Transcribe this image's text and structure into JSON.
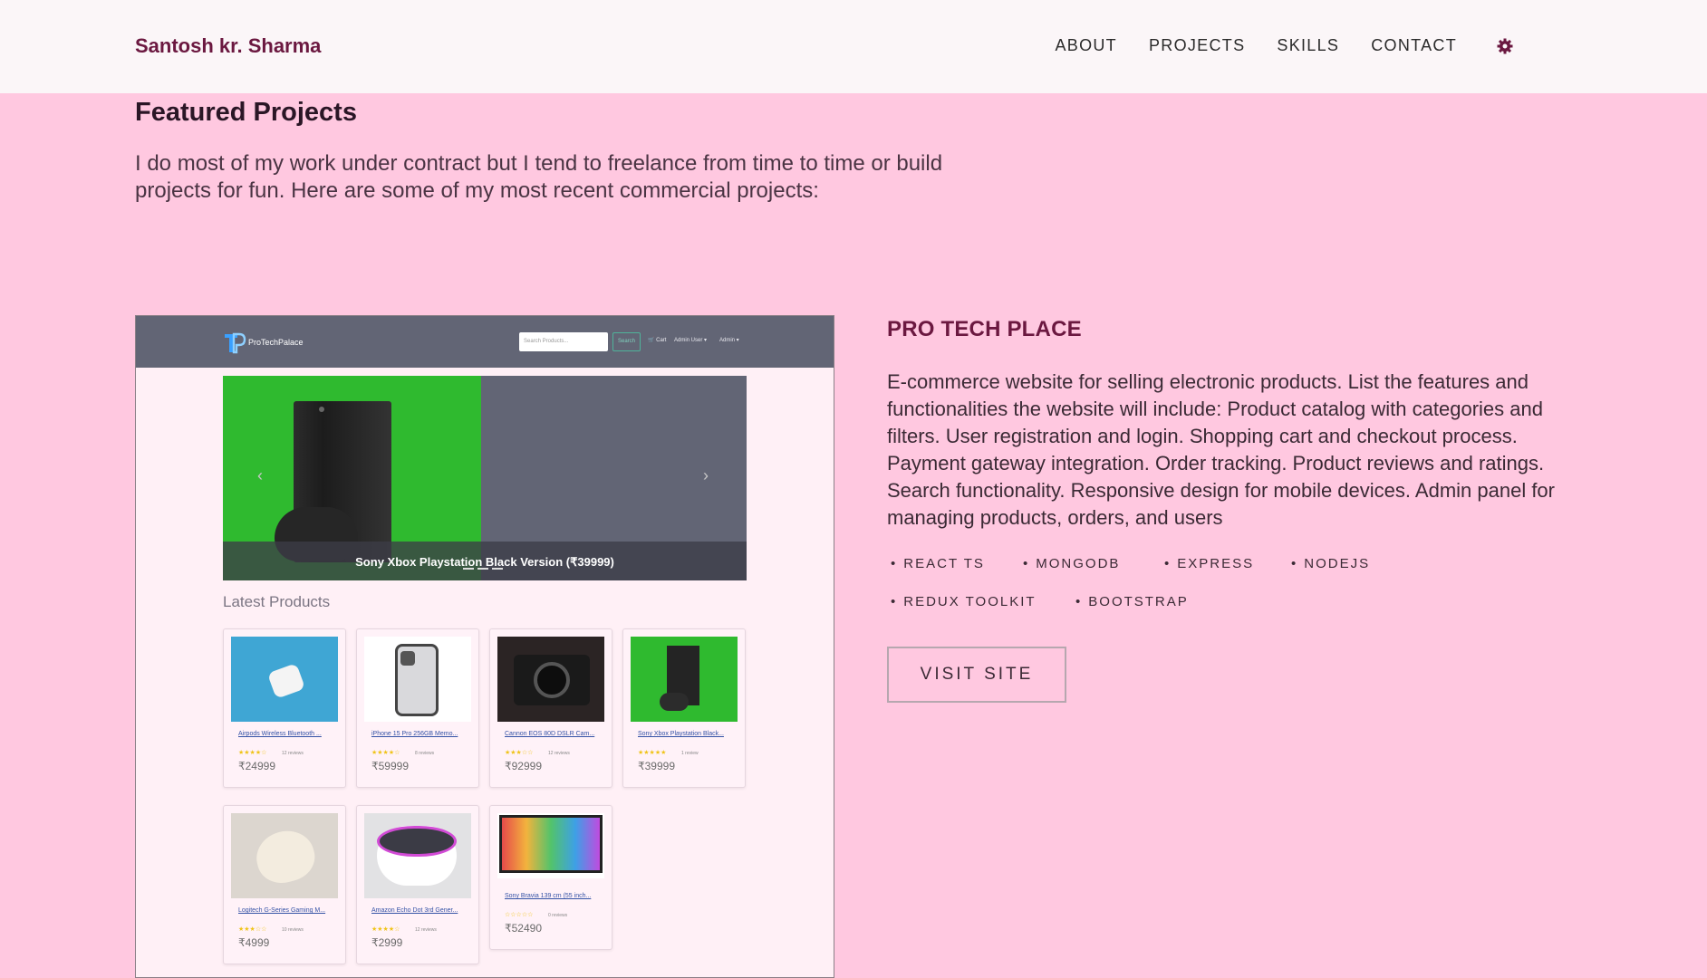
{
  "brand": {
    "name": "Santosh kr. Sharma"
  },
  "nav": {
    "items": [
      "ABOUT",
      "PROJECTS",
      "SKILLS",
      "CONTACT"
    ],
    "settings_icon": "gear-icon"
  },
  "section": {
    "title": "Featured Projects",
    "intro": "I do most of my work under contract but I tend to freelance from time to time or build projects for fun. Here are some of my most recent commercial projects:"
  },
  "project": {
    "title": "PRO TECH PLACE",
    "description": "E-commerce website for selling electronic products. List the features and functionalities the website will include: Product catalog with categories and filters. User registration and login. Shopping cart and checkout process. Payment gateway integration. Order tracking. Product reviews and ratings. Search functionality. Responsive design for mobile devices. Admin panel for managing products, orders, and users",
    "tags": [
      "REACT TS",
      "MONGODB",
      "EXPRESS",
      "NODEJS",
      "REDUX TOOLKIT",
      "BOOTSTRAP"
    ],
    "visit_label": "VISIT SITE"
  },
  "screenshot": {
    "logo_text": "ProTechPalace",
    "search_placeholder": "Search Products...",
    "search_button": "Search",
    "cart": "Cart",
    "admin_user": "Admin User",
    "admin": "Admin",
    "carousel_caption": "Sony Xbox Playstation Black Version (₹39999)",
    "latest_title": "Latest Products",
    "products": [
      {
        "name": "Airpods Wireless Bluetooth ...",
        "stars": "★★★★☆",
        "reviews": "12 reviews",
        "price": "₹24999"
      },
      {
        "name": "iPhone 15 Pro 256GB Memo...",
        "stars": "★★★★☆",
        "reviews": "8 reviews",
        "price": "₹59999"
      },
      {
        "name": "Cannon EOS 80D DSLR Cam...",
        "stars": "★★★☆☆",
        "reviews": "12 reviews",
        "price": "₹92999"
      },
      {
        "name": "Sony Xbox Playstation Black...",
        "stars": "★★★★★",
        "reviews": "1 review",
        "price": "₹39999"
      },
      {
        "name": "Logitech G-Series Gaming M...",
        "stars": "★★★☆☆",
        "reviews": "10 reviews",
        "price": "₹4999"
      },
      {
        "name": "Amazon Echo Dot 3rd Gener...",
        "stars": "★★★★☆",
        "reviews": "12 reviews",
        "price": "₹2999"
      },
      {
        "name": "Sony Bravia 139 cm (55 inch...",
        "stars": "☆☆☆☆☆",
        "reviews": "0 reviews",
        "price": "₹52490"
      }
    ]
  }
}
